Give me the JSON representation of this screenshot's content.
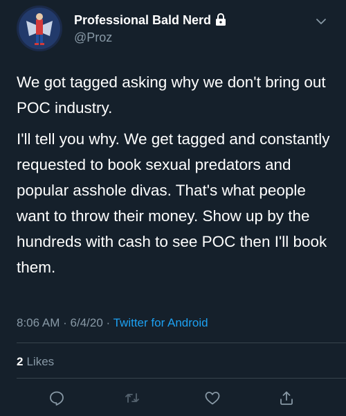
{
  "author": {
    "display_name": "Professional Bald Nerd",
    "handle": "@Proz"
  },
  "tweet": {
    "paragraphs": [
      "We got tagged asking why we don't bring out POC industry.",
      "I'll tell you why. We get tagged and constantly requested to book sexual predators and popular asshole divas. That's what people want to throw their money. Show up by the hundreds with cash to see POC then I'll book them."
    ]
  },
  "meta": {
    "time": "8:06 AM",
    "date": "6/4/20",
    "separator": "·",
    "source": "Twitter for Android"
  },
  "engagement": {
    "likes_count": "2",
    "likes_label": "Likes"
  },
  "actions": [
    "reply-icon",
    "retweet-icon",
    "like-icon",
    "share-icon"
  ],
  "colors": {
    "background": "#15202b",
    "text": "#ffffff",
    "secondary_text": "#8899a6",
    "link": "#1da1f2",
    "divider": "#38444d"
  }
}
